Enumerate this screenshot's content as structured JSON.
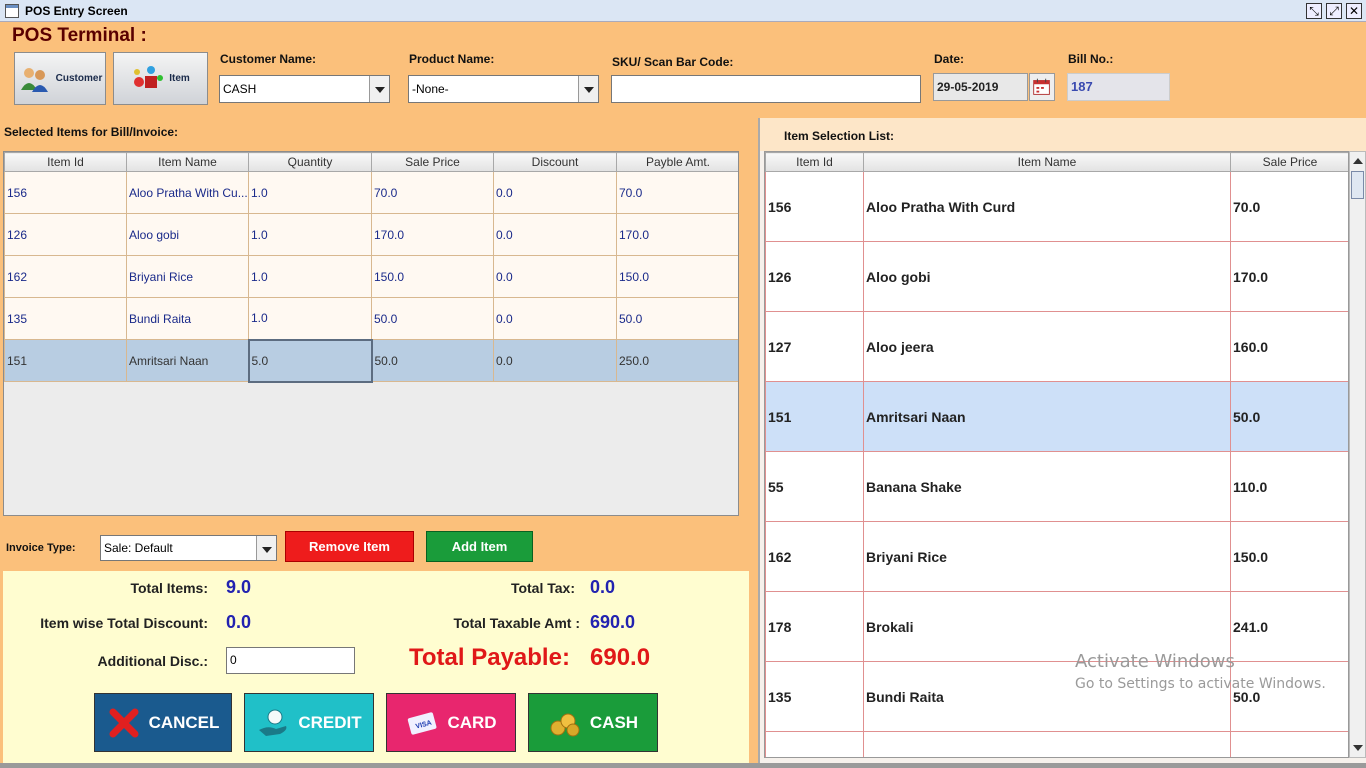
{
  "window": {
    "title": "POS Entry Screen"
  },
  "header": {
    "title": "POS Terminal :",
    "customer_btn": "Customer",
    "item_btn": "Item",
    "customer_label": "Customer Name:",
    "customer_value": "CASH",
    "product_label": "Product Name:",
    "product_value": "-None-",
    "sku_label": "SKU/ Scan Bar Code:",
    "sku_value": "",
    "date_label": "Date:",
    "date_value": "29-05-2019",
    "bill_label": "Bill No.:",
    "bill_value": "187"
  },
  "bill": {
    "section_label": "Selected Items for Bill/Invoice:",
    "columns": [
      "Item Id",
      "Item Name",
      "Quantity",
      "Sale Price",
      "Discount",
      "Payble Amt."
    ],
    "rows": [
      [
        "156",
        "Aloo Pratha With Cu...",
        "1.0",
        "70.0",
        "0.0",
        "70.0"
      ],
      [
        "126",
        "Aloo gobi",
        "1.0",
        "170.0",
        "0.0",
        "170.0"
      ],
      [
        "162",
        "Briyani Rice",
        "1.0",
        "150.0",
        "0.0",
        "150.0"
      ],
      [
        "135",
        "Bundi Raita",
        "1.0",
        "50.0",
        "0.0",
        "50.0"
      ],
      [
        "151",
        "Amritsari Naan",
        "5.0",
        "50.0",
        "0.0",
        "250.0"
      ]
    ],
    "selected_row": 4
  },
  "invoice": {
    "type_label": "Invoice Type:",
    "type_value": "Sale: Default",
    "remove_btn": "Remove Item",
    "add_btn": "Add Item"
  },
  "totals": {
    "total_items_label": "Total Items:",
    "total_items_value": "9.0",
    "total_tax_label": "Total Tax:",
    "total_tax_value": "0.0",
    "item_discount_label": "Item wise Total Discount:",
    "item_discount_value": "0.0",
    "taxable_label": "Total Taxable Amt :",
    "taxable_value": "690.0",
    "additional_disc_label": "Additional Disc.:",
    "additional_disc_value": "0",
    "payable_label": "Total Payable:",
    "payable_value": "690.0"
  },
  "actions": {
    "cancel": "CANCEL",
    "credit": "CREDIT",
    "card": "CARD",
    "cash": "CASH"
  },
  "item_list": {
    "section_label": "Item Selection List:",
    "columns": [
      "Item Id",
      "Item Name",
      "Sale Price"
    ],
    "rows": [
      [
        "156",
        "Aloo Pratha With Curd",
        "70.0"
      ],
      [
        "126",
        "Aloo gobi",
        "170.0"
      ],
      [
        "127",
        "Aloo jeera",
        "160.0"
      ],
      [
        "151",
        "Amritsari Naan",
        "50.0"
      ],
      [
        "55",
        "Banana Shake",
        "110.0"
      ],
      [
        "162",
        "Briyani Rice",
        "150.0"
      ],
      [
        "178",
        "Brokali",
        "241.0"
      ],
      [
        "135",
        "Bundi Raita",
        "50.0"
      ],
      [
        "",
        "",
        ""
      ]
    ],
    "selected_row": 3
  },
  "watermark": {
    "line1": "Activate Windows",
    "line2": "Go to Settings to activate Windows."
  },
  "colors": {
    "accent_bg": "#fbc07b",
    "remove": "#ee1c1c",
    "add": "#1a9c3a",
    "cancel": "#1a5a8e",
    "credit": "#20c0c8",
    "card": "#e8266e",
    "cash": "#1a9c3a",
    "payable": "#e01818",
    "value_blue": "#2222b0"
  },
  "icons": [
    "app-icon",
    "customer-icon",
    "item-icon",
    "calendar-icon",
    "cancel-x-icon",
    "credit-hand-icon",
    "card-icon",
    "cash-coins-icon"
  ]
}
